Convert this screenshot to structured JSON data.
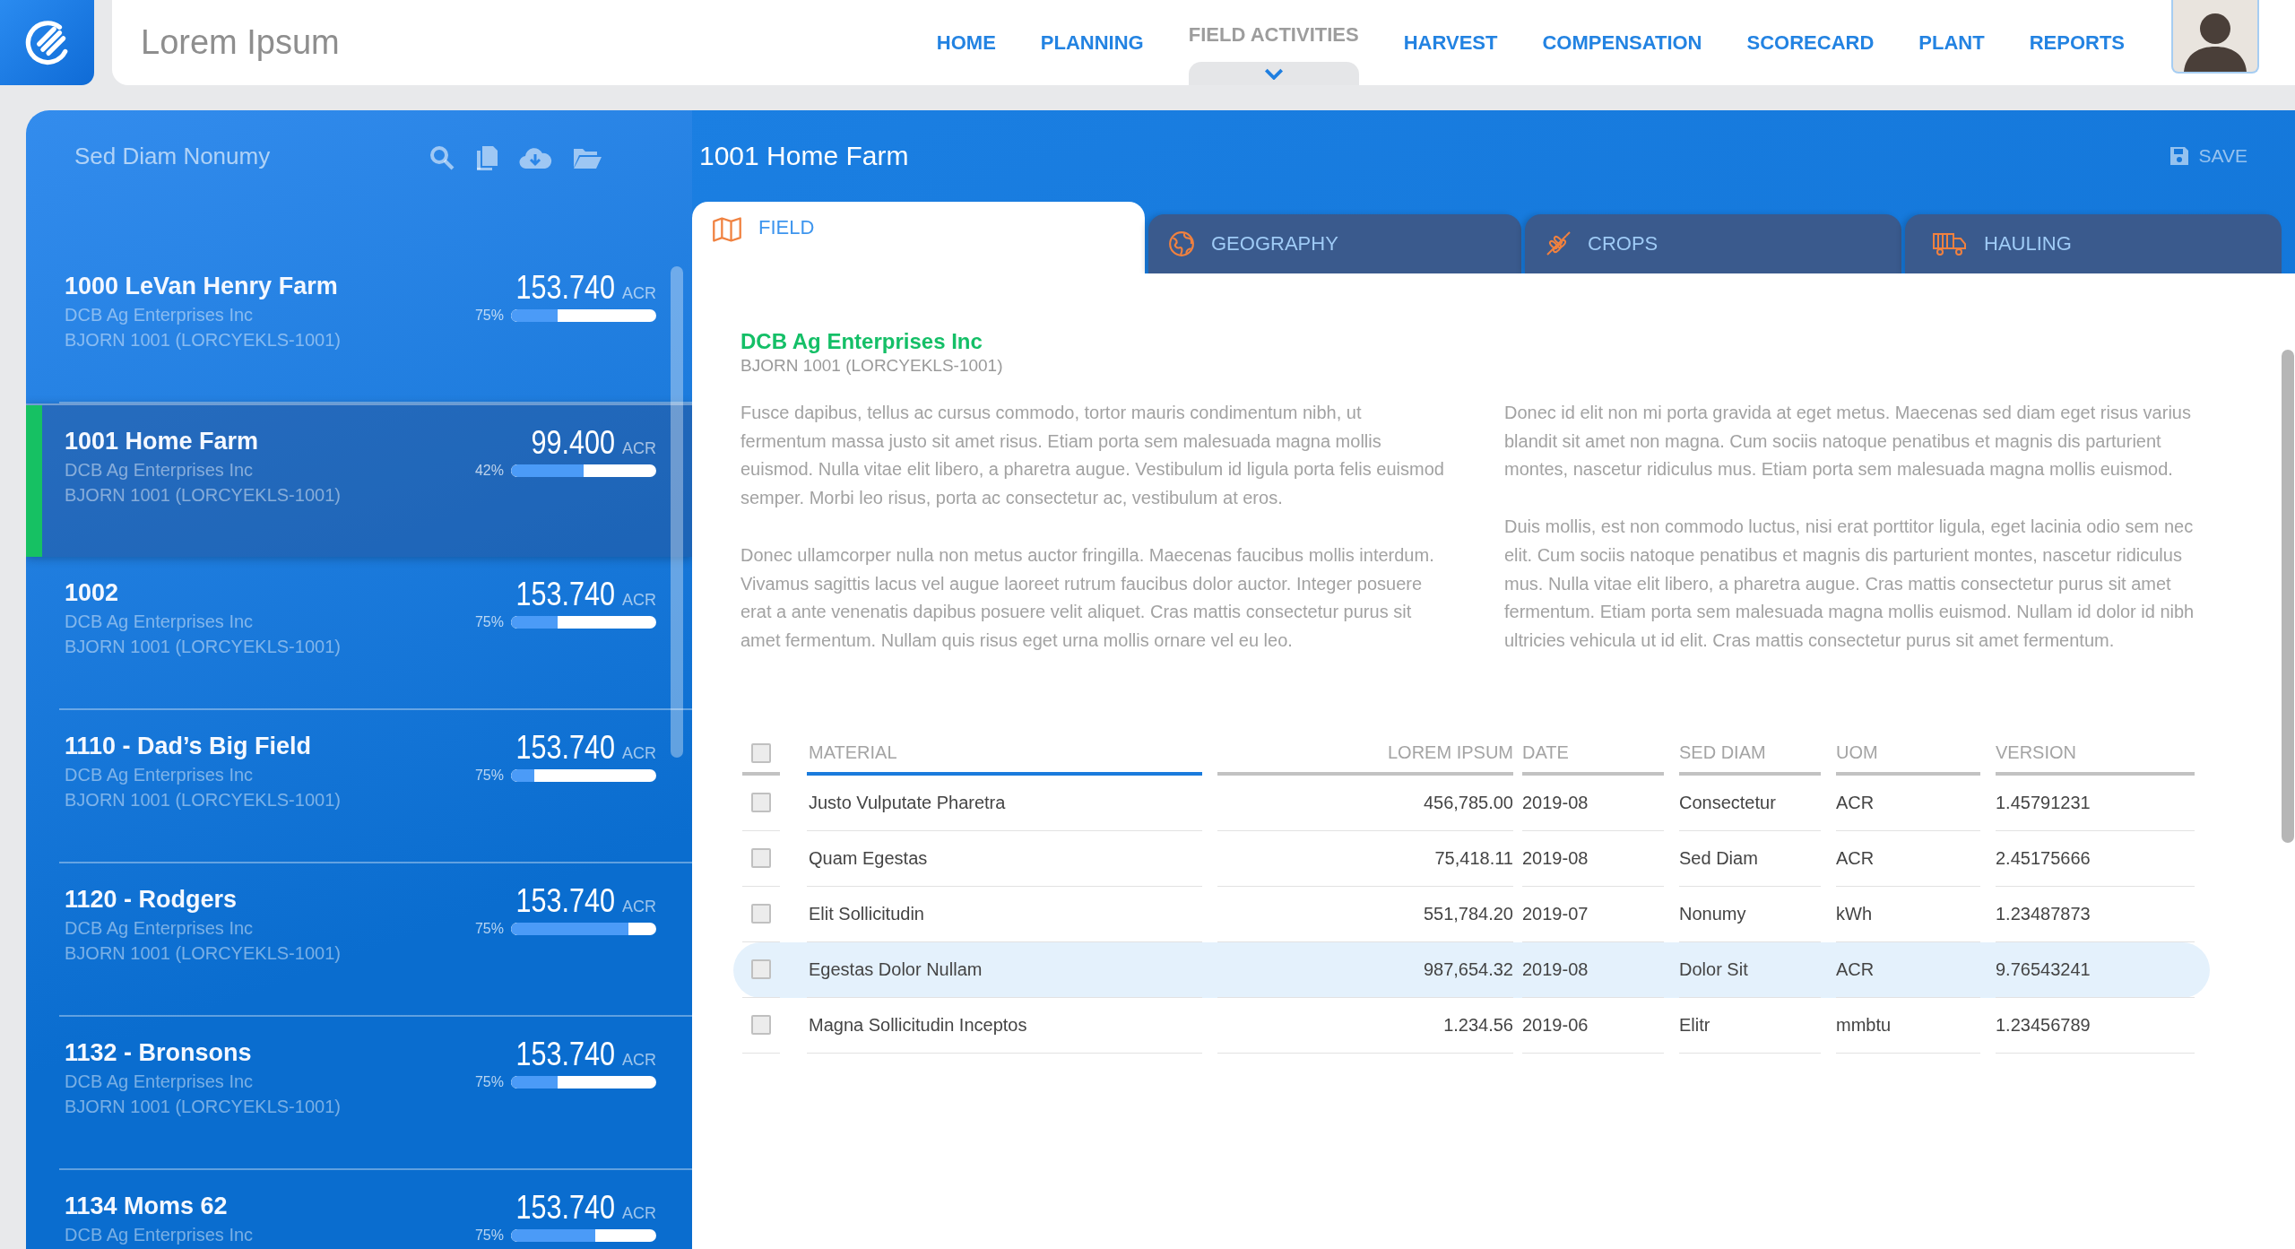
{
  "app": {
    "title": "Lorem Ipsum"
  },
  "nav": [
    {
      "label": "HOME",
      "selected": false
    },
    {
      "label": "PLANNING",
      "selected": false
    },
    {
      "label": "FIELD ACTIVITIES",
      "selected": true
    },
    {
      "label": "HARVEST",
      "selected": false
    },
    {
      "label": "COMPENSATION",
      "selected": false
    },
    {
      "label": "SCORECARD",
      "selected": false
    },
    {
      "label": "PLANT",
      "selected": false
    },
    {
      "label": "REPORTS",
      "selected": false
    }
  ],
  "sidebar": {
    "title": "Sed Diam Nonumy",
    "items": [
      {
        "name": "1000 LeVan Henry Farm",
        "company": "DCB Ag Enterprises Inc",
        "code": "BJORN 1001 (LORCYEKLS-1001)",
        "amount": "153.740",
        "unit": "ACR",
        "percent": "75%",
        "level": 0.32,
        "selected": false
      },
      {
        "name": "1001 Home Farm",
        "company": "DCB Ag Enterprises Inc",
        "code": "BJORN 1001 (LORCYEKLS-1001)",
        "amount": "99.400",
        "unit": "ACR",
        "percent": "42%",
        "level": 0.5,
        "selected": true
      },
      {
        "name": "1002",
        "company": "DCB Ag Enterprises Inc",
        "code": "BJORN 1001 (LORCYEKLS-1001)",
        "amount": "153.740",
        "unit": "ACR",
        "percent": "75%",
        "level": 0.32,
        "selected": false
      },
      {
        "name": "1110 - Dad’s Big Field",
        "company": "DCB Ag Enterprises Inc",
        "code": "BJORN 1001 (LORCYEKLS-1001)",
        "amount": "153.740",
        "unit": "ACR",
        "percent": "75%",
        "level": 0.16,
        "selected": false
      },
      {
        "name": "1120 - Rodgers",
        "company": "DCB Ag Enterprises Inc",
        "code": "BJORN 1001 (LORCYEKLS-1001)",
        "amount": "153.740",
        "unit": "ACR",
        "percent": "75%",
        "level": 0.81,
        "selected": false
      },
      {
        "name": "1132 - Bronsons",
        "company": "DCB Ag Enterprises Inc",
        "code": "BJORN 1001 (LORCYEKLS-1001)",
        "amount": "153.740",
        "unit": "ACR",
        "percent": "75%",
        "level": 0.32,
        "selected": false
      },
      {
        "name": "1134 Moms 62",
        "company": "DCB Ag Enterprises Inc",
        "amount": "153.740",
        "unit": "ACR",
        "percent": "75%",
        "level": 0.58,
        "selected": false
      }
    ]
  },
  "detail": {
    "title": "1001 Home Farm",
    "save": "SAVE",
    "tabs": [
      {
        "label": "FIELD",
        "selected": true
      },
      {
        "label": "GEOGRAPHY",
        "selected": false
      },
      {
        "label": "CROPS",
        "selected": false
      },
      {
        "label": "HAULING",
        "selected": false
      }
    ],
    "company": "DCB Ag Enterprises Inc",
    "code": "BJORN 1001 (LORCYEKLS-1001)",
    "text_columns": [
      [
        "Fusce dapibus, tellus ac cursus commodo, tortor mauris condimentum nibh, ut fermentum massa justo sit amet risus. Etiam porta sem malesuada magna mollis euismod. Nulla vitae elit libero, a pharetra augue. Vestibulum id ligula porta felis euismod semper. Morbi leo risus, porta ac consectetur ac, vestibulum at eros.",
        "Donec ullamcorper nulla non metus auctor fringilla. Maecenas faucibus mollis interdum. Vivamus sagittis lacus vel augue laoreet rutrum faucibus dolor auctor. Integer posuere erat a ante venenatis dapibus posuere velit aliquet. Cras mattis consectetur purus sit amet fermentum. Nullam quis risus eget urna mollis ornare vel eu leo."
      ],
      [
        "Donec id elit non mi porta gravida at eget metus. Maecenas sed diam eget risus varius blandit sit amet non magna. Cum sociis natoque penatibus et magnis dis parturient montes, nascetur ridiculus mus. Etiam porta sem malesuada magna mollis euismod.",
        "Duis mollis, est non commodo luctus, nisi erat porttitor ligula, eget lacinia odio sem nec elit. Cum sociis natoque penatibus et magnis dis parturient montes, nascetur ridiculus mus. Nulla vitae elit libero, a pharetra augue. Cras mattis consectetur purus sit amet fermentum. Etiam porta sem malesuada magna mollis euismod. Nullam id dolor id nibh ultricies vehicula ut id elit. Cras mattis consectetur purus sit amet fermentum."
      ]
    ],
    "table": {
      "header_checked": false,
      "columns": [
        {
          "label": "MATERIAL",
          "sorted": true
        },
        {
          "label": "LOREM IPSUM",
          "sorted": false
        },
        {
          "label": "DATE",
          "sorted": false
        },
        {
          "label": "SED DIAM",
          "sorted": false
        },
        {
          "label": "UOM",
          "sorted": false
        },
        {
          "label": "VERSION",
          "sorted": false
        }
      ],
      "rows": [
        {
          "checked": false,
          "selected": false,
          "cells": [
            "Justo Vulputate Pharetra",
            "456,785.00",
            "2019-08",
            "Consectetur",
            "ACR",
            "1.45791231"
          ]
        },
        {
          "checked": false,
          "selected": false,
          "cells": [
            "Quam Egestas",
            "75,418.11",
            "2019-08",
            "Sed Diam",
            "ACR",
            "2.45175666"
          ]
        },
        {
          "checked": false,
          "selected": false,
          "cells": [
            "Elit Sollicitudin",
            "551,784.20",
            "2019-07",
            "Nonumy",
            "kWh",
            "1.23487873"
          ]
        },
        {
          "checked": false,
          "selected": true,
          "cells": [
            "Egestas Dolor Nullam",
            "987,654.32",
            "2019-08",
            "Dolor Sit",
            "ACR",
            "9.76543241"
          ]
        },
        {
          "checked": false,
          "selected": false,
          "cells": [
            "Magna Sollicitudin Inceptos",
            "1.234.56",
            "2019-06",
            "Elitr",
            "mmbtu",
            "1.23456789"
          ]
        }
      ]
    }
  }
}
